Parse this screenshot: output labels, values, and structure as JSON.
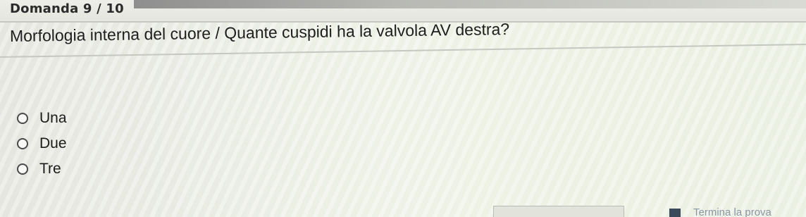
{
  "header": {
    "question_number": "Domanda 9 / 10"
  },
  "question": {
    "text": "Morfologia interna del cuore / Quante cuspidi ha la valvola AV destra?"
  },
  "options": [
    {
      "label": "Una"
    },
    {
      "label": "Due"
    },
    {
      "label": "Tre"
    }
  ],
  "footer": {
    "finish_link": "Termina la prova"
  }
}
